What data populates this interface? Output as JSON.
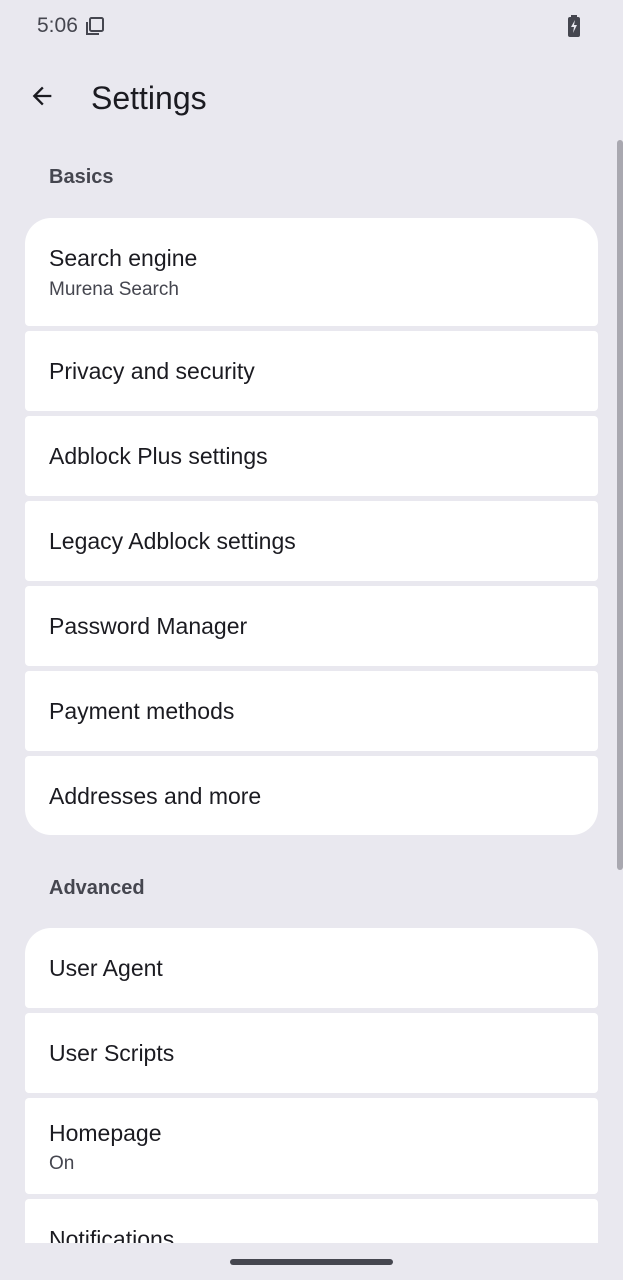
{
  "status_bar": {
    "time": "5:06",
    "notification_icon": "screenshot-notification-icon",
    "battery_icon": "battery-charging-icon"
  },
  "header": {
    "title": "Settings",
    "back_icon": "arrow-back-icon"
  },
  "sections": {
    "basics": {
      "header": "Basics",
      "items": [
        {
          "title": "Search engine",
          "summary": "Murena Search"
        },
        {
          "title": "Privacy and security"
        },
        {
          "title": "Adblock Plus settings"
        },
        {
          "title": "Legacy Adblock settings"
        },
        {
          "title": "Password Manager"
        },
        {
          "title": "Payment methods"
        },
        {
          "title": "Addresses and more"
        }
      ]
    },
    "advanced": {
      "header": "Advanced",
      "items": [
        {
          "title": "User Agent"
        },
        {
          "title": "User Scripts"
        },
        {
          "title": "Homepage",
          "summary": "On"
        },
        {
          "title": "Notifications"
        }
      ]
    }
  },
  "colors": {
    "background": "#E9E8EF",
    "surface": "#FFFFFF",
    "text_primary": "#1B1B21",
    "text_secondary": "#45464F"
  }
}
